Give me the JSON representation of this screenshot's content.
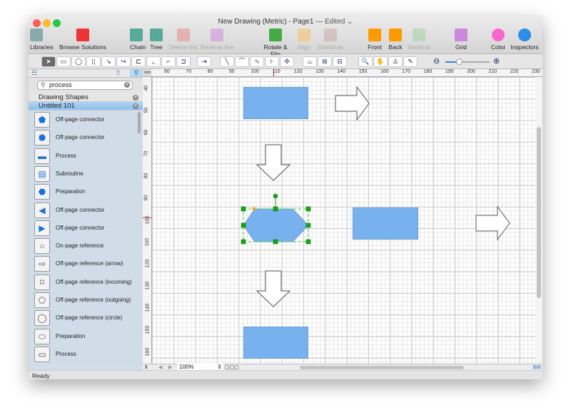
{
  "window": {
    "title": "New Drawing (Metric) - Page1",
    "edited": "— Edited ⌄"
  },
  "toolbar": [
    {
      "label": "Libraries",
      "enabled": true
    },
    {
      "label": "Browse Solutions",
      "enabled": true
    },
    {
      "label": "Chain",
      "enabled": true
    },
    {
      "label": "Tree",
      "enabled": true
    },
    {
      "label": "Delete link",
      "enabled": false
    },
    {
      "label": "Reverse link",
      "enabled": false
    },
    {
      "label": "Rotate & Flip",
      "enabled": true
    },
    {
      "label": "Align",
      "enabled": false
    },
    {
      "label": "Distribute",
      "enabled": false
    },
    {
      "label": "Front",
      "enabled": true
    },
    {
      "label": "Back",
      "enabled": true
    },
    {
      "label": "Identical",
      "enabled": false
    },
    {
      "label": "Grid",
      "enabled": true
    },
    {
      "label": "Color",
      "enabled": true
    },
    {
      "label": "Inspectors",
      "enabled": true
    }
  ],
  "search": {
    "value": "process"
  },
  "groups": [
    "Drawing Shapes",
    "Untitled 101"
  ],
  "shapes": [
    "Off-page connector",
    "Off-page connector",
    "Process",
    "Subroutine",
    "Preparation",
    "Off-page connector",
    "Off-page connector",
    "On-page reference",
    "Off-page reference (arrow)",
    "Off-page reference (incoming)",
    "Off-page reference (outgoing)",
    "Off-page reference (circle)",
    "Preparation",
    "Process"
  ],
  "ruler": {
    "unit": "mm",
    "h": [
      "60",
      "70",
      "80",
      "90",
      "100",
      "110",
      "120",
      "130",
      "140",
      "150",
      "160",
      "170",
      "180",
      "190",
      "200",
      "210",
      "220",
      "230"
    ],
    "v": [
      "40",
      "50",
      "60",
      "70",
      "80",
      "90",
      "100",
      "110",
      "120",
      "130",
      "140",
      "150",
      "160"
    ]
  },
  "zoom": {
    "value": "100%",
    "slider": 0.3
  },
  "status": "Ready",
  "colors": {
    "shape": "#78b2ee",
    "selection": "#22aa22"
  }
}
